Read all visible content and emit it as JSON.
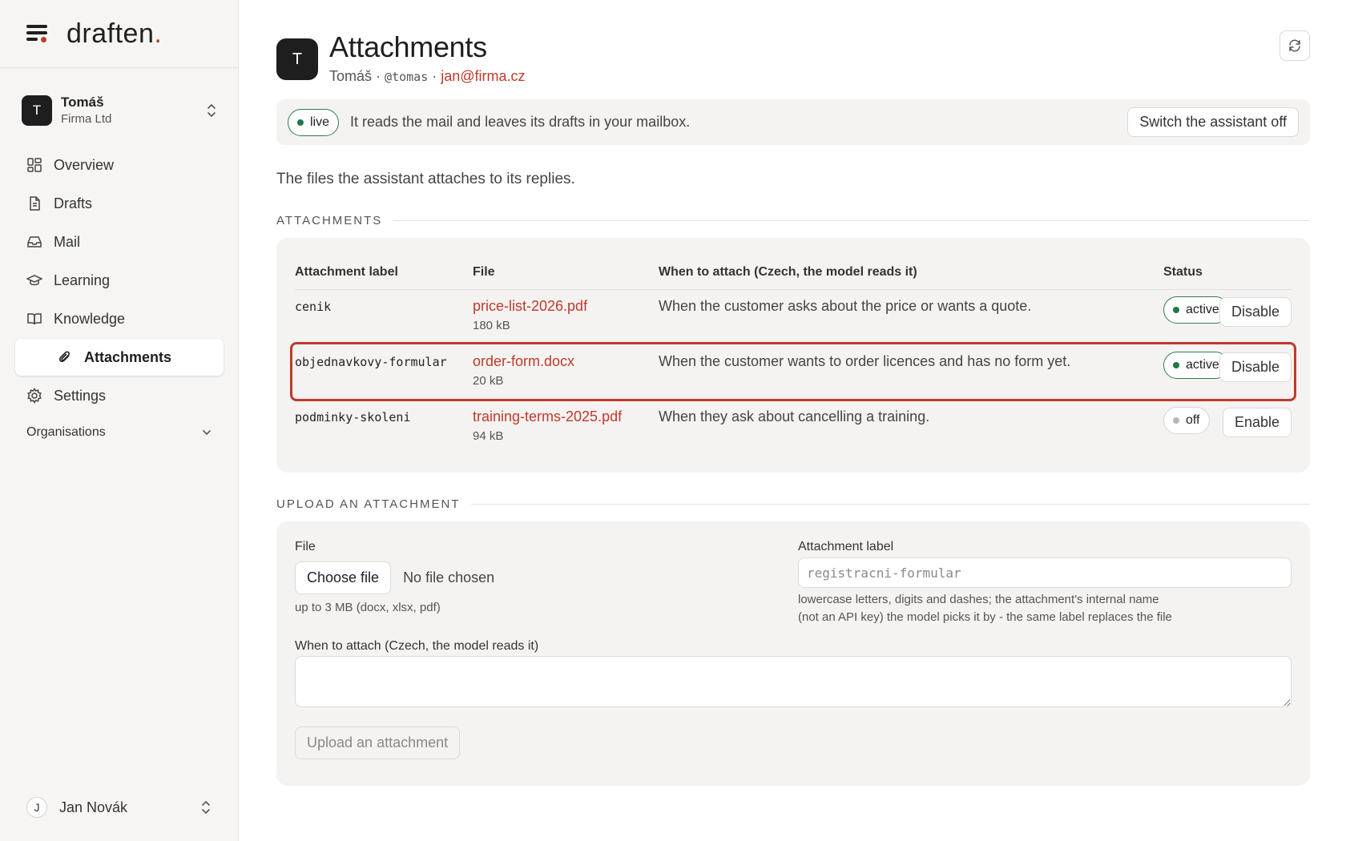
{
  "app": {
    "brand_name": "draften",
    "brand_dot": "."
  },
  "account": {
    "initial": "T",
    "name": "Tomáš",
    "org": "Firma Ltd"
  },
  "nav": {
    "items": [
      {
        "label": "Overview",
        "icon": "grid-icon"
      },
      {
        "label": "Drafts",
        "icon": "document-icon"
      },
      {
        "label": "Mail",
        "icon": "inbox-icon"
      },
      {
        "label": "Learning",
        "icon": "graduation-cap-icon"
      },
      {
        "label": "Knowledge",
        "icon": "book-icon"
      },
      {
        "label": "Attachments",
        "icon": "paperclip-icon",
        "active": true
      },
      {
        "label": "Settings",
        "icon": "gear-icon"
      }
    ],
    "organisations_label": "Organisations"
  },
  "user": {
    "initial": "J",
    "name": "Jan Novák"
  },
  "header": {
    "initial": "T",
    "title": "Attachments",
    "name": "Tomáš",
    "sep": "·",
    "handle": "@tomas",
    "email": "jan@firma.cz"
  },
  "banner": {
    "status": "live",
    "text": "It reads the mail and leaves its drafts in your mailbox.",
    "button": "Switch the assistant off"
  },
  "intro": "The files the assistant attaches to its replies.",
  "attachments": {
    "section_title": "ATTACHMENTS",
    "columns": {
      "label": "Attachment label",
      "file": "File",
      "when": "When to attach (Czech, the model reads it)",
      "status": "Status"
    },
    "rows": [
      {
        "label": "cenik",
        "file": "price-list-2026.pdf",
        "size": "180 kB",
        "when": "When the customer asks about the price or wants a quote.",
        "status": "active",
        "action": "Disable"
      },
      {
        "label": "objednavkovy-formular",
        "file": "order-form.docx",
        "size": "20 kB",
        "when": "When the customer wants to order licences and has no form yet.",
        "status": "active",
        "action": "Disable"
      },
      {
        "label": "podminky-skoleni",
        "file": "training-terms-2025.pdf",
        "size": "94 kB",
        "when": "When they ask about cancelling a training.",
        "status": "off",
        "action": "Enable"
      }
    ]
  },
  "upload": {
    "section_title": "UPLOAD AN ATTACHMENT",
    "file_label": "File",
    "choose_button": "Choose file",
    "no_file": "No file chosen",
    "file_hint": "up to 3 MB (docx, xlsx, pdf)",
    "label_label": "Attachment label",
    "label_placeholder": "registracni-formular",
    "label_hint_1": "lowercase letters, digits and dashes; the attachment's internal name",
    "label_hint_2": "(not an API key) the model picks it by - the same label replaces the file",
    "when_label": "When to attach (Czech, the model reads it)",
    "submit": "Upload an attachment"
  },
  "colors": {
    "accent": "#c0392b",
    "live_green": "#1e7a45"
  }
}
